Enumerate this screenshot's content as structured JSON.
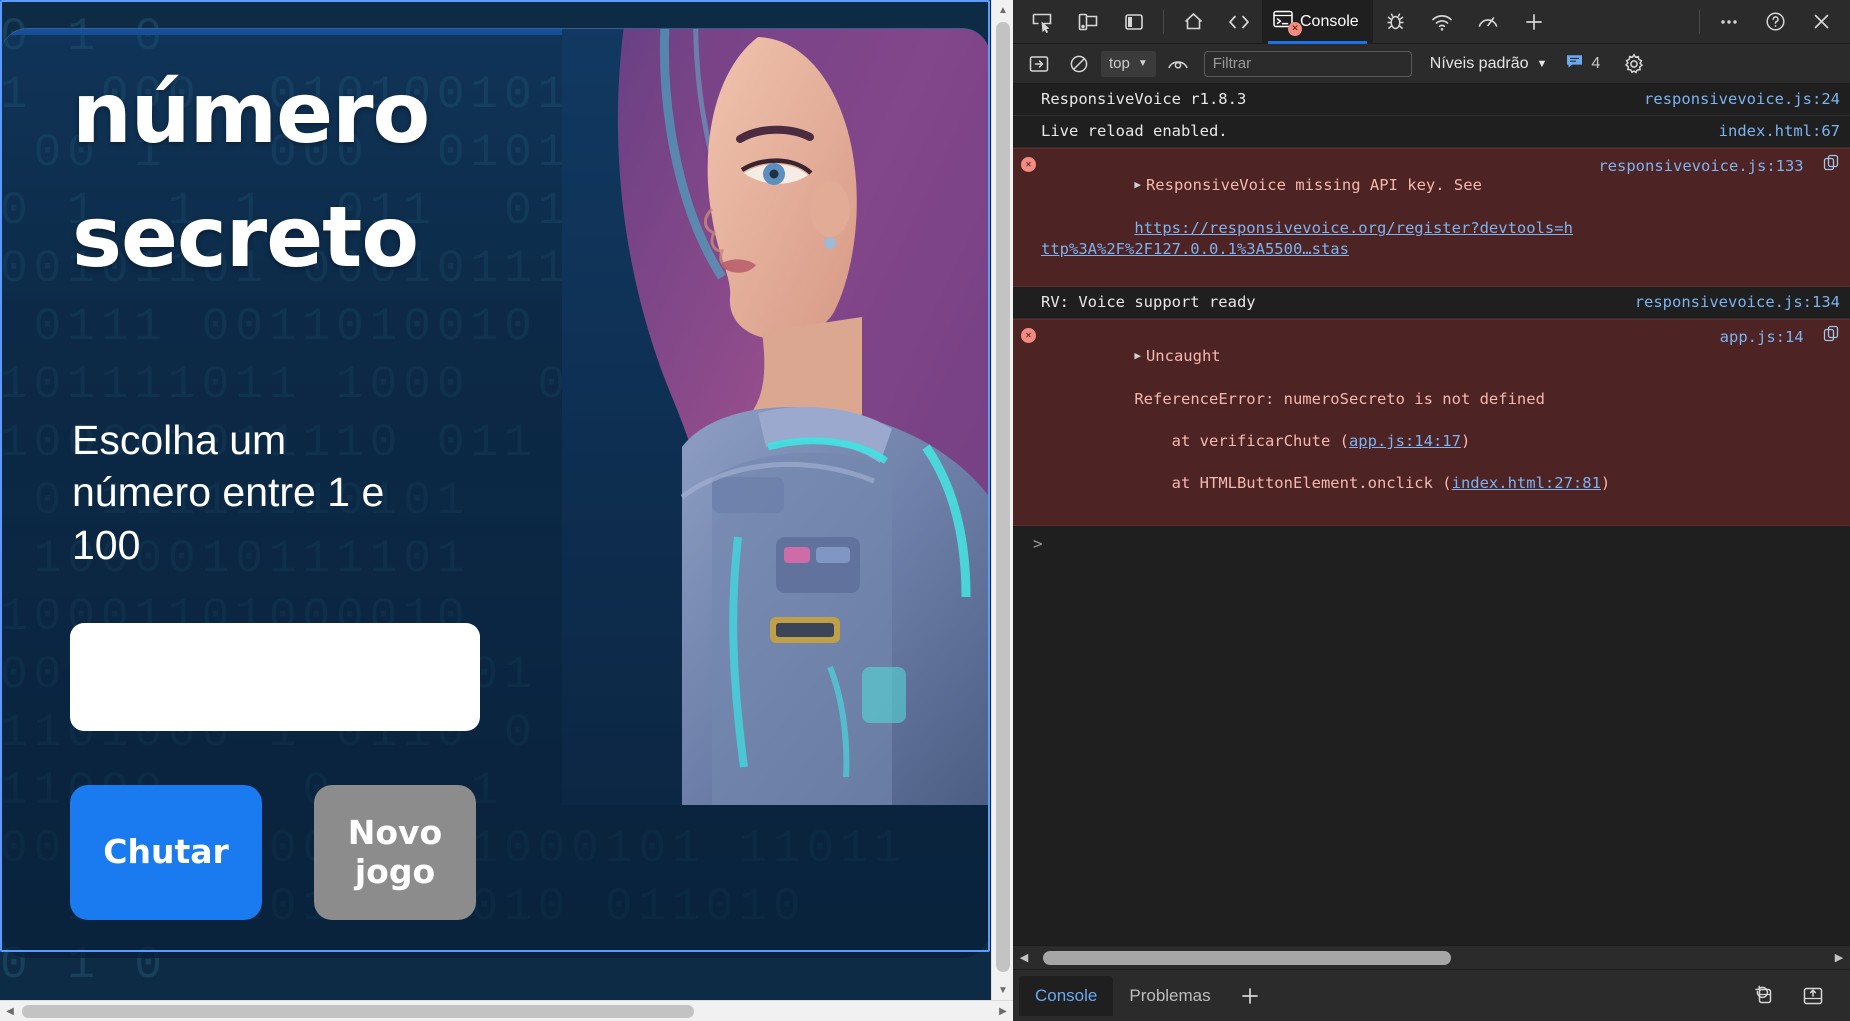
{
  "page": {
    "title": "número secreto",
    "subtitle": "Escolha um número entre 1 e 100",
    "input_value": "",
    "input_placeholder": "",
    "buttons": {
      "primary": "Chutar",
      "secondary": "Novo jogo"
    },
    "colors": {
      "card_bg": "#0e2b46",
      "primary_button": "#1a7bf0",
      "secondary_button": "#8c8c8c",
      "title_color": "#ffffff"
    },
    "binary_background_rows": [
      "0 1 0",
      "1  000  010100101001",
      " 00 1   000  010100101001",
      "0 1  1 1  011  0110  1",
      "00101101 00010111 101",
      " 0111 0011010010 01100",
      "101111011 1000  0",
      "100001011110 011",
      " 0 11111110101",
      " 1000010111101",
      "10001101000010",
      "0010  11  10 101  10",
      "1101000 1 0110 0",
      "11000    0    1   0",
      "0011000000 1101000101 11011",
      "  101101010 1 010 011010 "
    ]
  },
  "devtools": {
    "toolbar": {
      "icons": [
        {
          "name": "inspect-element-icon",
          "title": "Inspecionar"
        },
        {
          "name": "device-emulation-icon",
          "title": "Emulação de dispositivo"
        },
        {
          "name": "panel-layout-icon",
          "title": "Layout do painel"
        },
        {
          "name": "home-icon",
          "title": "Bem-vindo"
        },
        {
          "name": "elements-icon",
          "title": "Elementos"
        },
        {
          "name": "console-icon",
          "title": "Console"
        },
        {
          "name": "debugger-icon",
          "title": "Depurador"
        },
        {
          "name": "network-icon",
          "title": "Rede"
        },
        {
          "name": "performance-icon",
          "title": "Desempenho"
        },
        {
          "name": "add-tab-icon",
          "title": "Mais ferramentas"
        },
        {
          "name": "more-options-icon",
          "title": "Mais opções"
        },
        {
          "name": "help-icon",
          "title": "Ajuda"
        },
        {
          "name": "close-icon",
          "title": "Fechar"
        }
      ],
      "active_tab": "Console",
      "more_label": "•••",
      "help_label": "?",
      "close_label": "✕",
      "plus_label": "+"
    },
    "filterbar": {
      "sidebar_toggle_name": "console-sidebar-icon",
      "clear_label": "Limpar console",
      "context": "top",
      "eye_label": "Live expressions",
      "filter_placeholder": "Filtrar",
      "filter_value": "",
      "levels_label": "Níveis padrão",
      "message_count": "4",
      "settings_label": "Configurações"
    },
    "console_messages": [
      {
        "level": "info",
        "text": "ResponsiveVoice r1.8.3",
        "source": "responsivevoice.js:24",
        "expandable": false
      },
      {
        "level": "info",
        "text": "Live reload enabled.",
        "source": "index.html:67",
        "expandable": false
      },
      {
        "level": "error",
        "text": "ResponsiveVoice missing API key. See",
        "url": "https://responsivevoice.org/register?devtools=http%3A%2F%2F127.0.0.1%3A5500…stas",
        "source": "responsivevoice.js:133",
        "expandable": true,
        "has_copy_icon": true
      },
      {
        "level": "info",
        "text": "RV: Voice support ready",
        "source": "responsivevoice.js:134",
        "expandable": false
      },
      {
        "level": "error",
        "text": "Uncaught",
        "stack_head": "ReferenceError: numeroSecreto is not defined",
        "stack": [
          {
            "prefix": "    at verificarChute (",
            "link": "app.js:14:17",
            "suffix": ")"
          },
          {
            "prefix": "    at HTMLButtonElement.onclick (",
            "link": "index.html:27:81",
            "suffix": ")"
          }
        ],
        "source": "app.js:14",
        "expandable": true,
        "has_copy_icon": true
      }
    ],
    "prompt": ">",
    "bottom": {
      "tabs": [
        {
          "label": "Console",
          "active": true
        },
        {
          "label": "Problemas",
          "active": false
        }
      ],
      "plus_label": "+",
      "right_icons": [
        {
          "name": "restore-drawer-icon"
        },
        {
          "name": "dock-panel-icon"
        }
      ]
    }
  }
}
